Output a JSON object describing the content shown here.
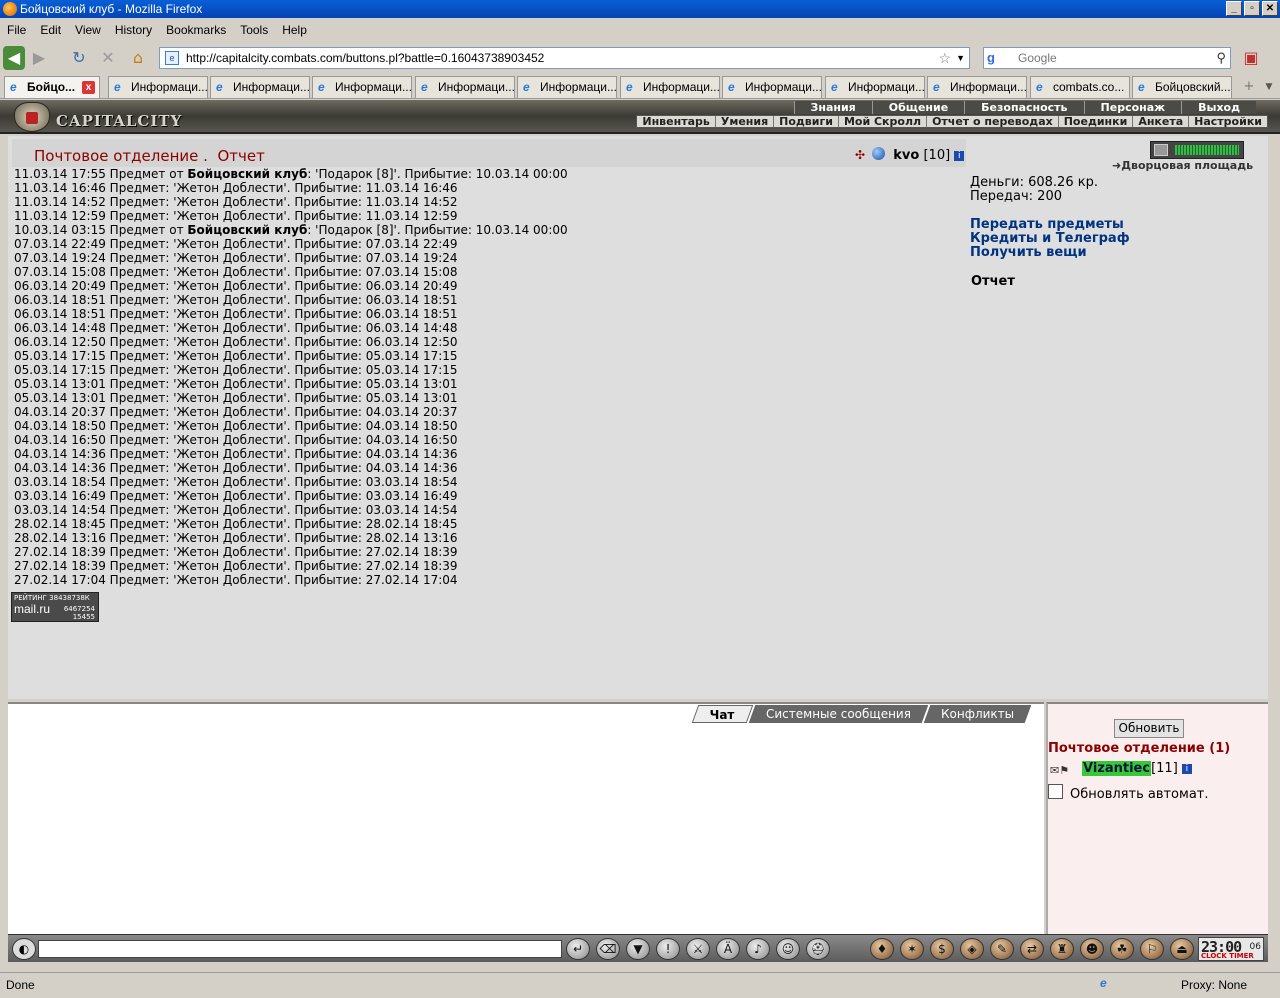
{
  "window": {
    "title": "Бойцовский клуб - Mozilla Firefox"
  },
  "menu": [
    "File",
    "Edit",
    "View",
    "History",
    "Bookmarks",
    "Tools",
    "Help"
  ],
  "address": {
    "url": "http://capitalcity.combats.com/buttons.pl?battle=0.16043738903452"
  },
  "search": {
    "placeholder": "Google",
    "engine_glyph": "g"
  },
  "tabs": [
    {
      "label": "Бойцо...",
      "active": true
    },
    {
      "label": "Информаци..."
    },
    {
      "label": "Информаци..."
    },
    {
      "label": "Информаци..."
    },
    {
      "label": "Информаци..."
    },
    {
      "label": "Информаци..."
    },
    {
      "label": "Информаци..."
    },
    {
      "label": "Информаци..."
    },
    {
      "label": "Информаци..."
    },
    {
      "label": "Информаци..."
    },
    {
      "label": "combats.co..."
    },
    {
      "label": "Бойцовский..."
    }
  ],
  "game": {
    "logo_text": "CAPITALCITY",
    "top_menu": [
      "Знания",
      "Общение",
      "Безопасность",
      "Персонаж",
      "Выход"
    ],
    "sub_menu": [
      "Инвентарь",
      "Умения",
      "Подвиги",
      "Мой Скролл",
      "Отчет о переводах",
      "Поединки",
      "Анкета",
      "Настройки"
    ]
  },
  "page": {
    "title": "Почтовое отделение .",
    "subtitle": "Отчет",
    "user": {
      "name": "kvo",
      "level": "[10]"
    }
  },
  "log": [
    {
      "time": "11.03.14 17:55",
      "pre": "Предмет от",
      "from": "Бойцовский клуб",
      "post": ": 'Подарок [8]'. Прибытие: 10.03.14 00:00"
    },
    {
      "time": "11.03.14 16:46",
      "pre": "Предмет: 'Жетон Доблести'. Прибытие: 11.03.14 16:46"
    },
    {
      "time": "11.03.14 14:52",
      "pre": "Предмет: 'Жетон Доблести'. Прибытие: 11.03.14 14:52"
    },
    {
      "time": "11.03.14 12:59",
      "pre": "Предмет: 'Жетон Доблести'. Прибытие: 11.03.14 12:59"
    },
    {
      "time": "10.03.14 03:15",
      "pre": "Предмет от",
      "from": "Бойцовский клуб",
      "post": ": 'Подарок [8]'. Прибытие: 10.03.14 00:00"
    },
    {
      "time": "07.03.14 22:49",
      "pre": "Предмет: 'Жетон Доблести'. Прибытие: 07.03.14 22:49"
    },
    {
      "time": "07.03.14 19:24",
      "pre": "Предмет: 'Жетон Доблести'. Прибытие: 07.03.14 19:24"
    },
    {
      "time": "07.03.14 15:08",
      "pre": "Предмет: 'Жетон Доблести'. Прибытие: 07.03.14 15:08"
    },
    {
      "time": "06.03.14 20:49",
      "pre": "Предмет: 'Жетон Доблести'. Прибытие: 06.03.14 20:49"
    },
    {
      "time": "06.03.14 18:51",
      "pre": "Предмет: 'Жетон Доблести'. Прибытие: 06.03.14 18:51"
    },
    {
      "time": "06.03.14 18:51",
      "pre": "Предмет: 'Жетон Доблести'. Прибытие: 06.03.14 18:51"
    },
    {
      "time": "06.03.14 14:48",
      "pre": "Предмет: 'Жетон Доблести'. Прибытие: 06.03.14 14:48"
    },
    {
      "time": "06.03.14 12:50",
      "pre": "Предмет: 'Жетон Доблести'. Прибытие: 06.03.14 12:50"
    },
    {
      "time": "05.03.14 17:15",
      "pre": "Предмет: 'Жетон Доблести'. Прибытие: 05.03.14 17:15"
    },
    {
      "time": "05.03.14 17:15",
      "pre": "Предмет: 'Жетон Доблести'. Прибытие: 05.03.14 17:15"
    },
    {
      "time": "05.03.14 13:01",
      "pre": "Предмет: 'Жетон Доблести'. Прибытие: 05.03.14 13:01"
    },
    {
      "time": "05.03.14 13:01",
      "pre": "Предмет: 'Жетон Доблести'. Прибытие: 05.03.14 13:01"
    },
    {
      "time": "04.03.14 20:37",
      "pre": "Предмет: 'Жетон Доблести'. Прибытие: 04.03.14 20:37"
    },
    {
      "time": "04.03.14 18:50",
      "pre": "Предмет: 'Жетон Доблести'. Прибытие: 04.03.14 18:50"
    },
    {
      "time": "04.03.14 16:50",
      "pre": "Предмет: 'Жетон Доблести'. Прибытие: 04.03.14 16:50"
    },
    {
      "time": "04.03.14 14:36",
      "pre": "Предмет: 'Жетон Доблести'. Прибытие: 04.03.14 14:36"
    },
    {
      "time": "04.03.14 14:36",
      "pre": "Предмет: 'Жетон Доблести'. Прибытие: 04.03.14 14:36"
    },
    {
      "time": "03.03.14 18:54",
      "pre": "Предмет: 'Жетон Доблести'. Прибытие: 03.03.14 18:54"
    },
    {
      "time": "03.03.14 16:49",
      "pre": "Предмет: 'Жетон Доблести'. Прибытие: 03.03.14 16:49"
    },
    {
      "time": "03.03.14 14:54",
      "pre": "Предмет: 'Жетон Доблести'. Прибытие: 03.03.14 14:54"
    },
    {
      "time": "28.02.14 18:45",
      "pre": "Предмет: 'Жетон Доблести'. Прибытие: 28.02.14 18:45"
    },
    {
      "time": "28.02.14 13:16",
      "pre": "Предмет: 'Жетон Доблести'. Прибытие: 28.02.14 13:16"
    },
    {
      "time": "27.02.14 18:39",
      "pre": "Предмет: 'Жетон Доблести'. Прибытие: 27.02.14 18:39"
    },
    {
      "time": "27.02.14 18:39",
      "pre": "Предмет: 'Жетон Доблести'. Прибытие: 27.02.14 18:39"
    },
    {
      "time": "27.02.14 17:04",
      "pre": "Предмет: 'Жетон Доблести'. Прибытие: 27.02.14 17:04"
    }
  ],
  "rating": {
    "label": "РЕЙТИНГ",
    "id": "38438738К",
    "mail": "mail.ru",
    "n1": "6467254",
    "n2": "15455"
  },
  "side": {
    "location": "Дворцовая площадь",
    "money": "Деньги: 608.26 кр.",
    "transfers": "Передач: 200",
    "links": [
      "Передать предметы",
      "Кредиты и Телеграф",
      "Получить вещи"
    ],
    "report": "Отчет"
  },
  "chat": {
    "tabs": [
      "Чат",
      "Системные сообщения",
      "Конфликты"
    ]
  },
  "online": {
    "refresh": "Обновить",
    "room": "Почтовое отделение (1)",
    "user": {
      "name": "Vizantiec",
      "level": "[11]"
    },
    "auto": "Обновлять автомат."
  },
  "clock": {
    "time": "23:00",
    "sec": "06",
    "label": "CLOCK TIMER"
  },
  "status": {
    "text": "Done",
    "proxy": "Proxy: None"
  }
}
